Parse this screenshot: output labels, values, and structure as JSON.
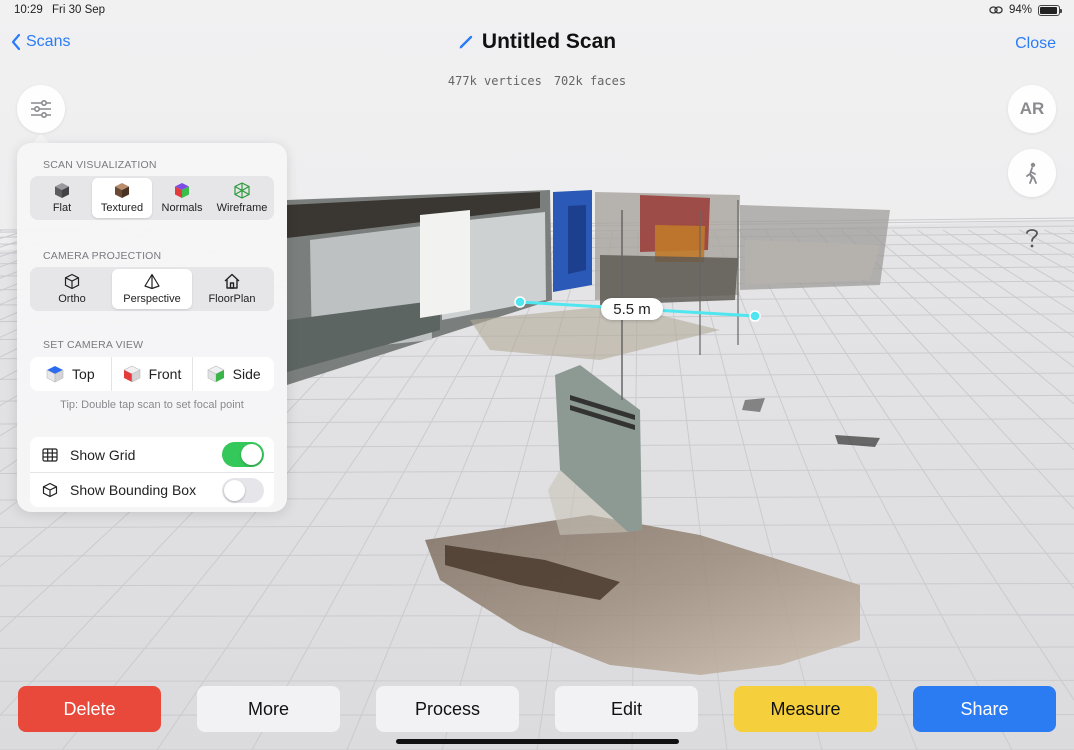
{
  "status_bar": {
    "time": "10:29",
    "date": "Fri 30 Sep",
    "battery": "94%",
    "battery_level": 0.94
  },
  "nav": {
    "back_label": "Scans",
    "title": "Untitled Scan",
    "close_label": "Close"
  },
  "stats": {
    "vertices": "477k vertices",
    "faces": "702k faces"
  },
  "buttons": {
    "ar_label": "AR"
  },
  "panel": {
    "visualization": {
      "title": "SCAN VISUALIZATION",
      "items": [
        {
          "label": "Flat",
          "icon": "cube-flat-icon"
        },
        {
          "label": "Textured",
          "icon": "cube-textured-icon",
          "selected": true
        },
        {
          "label": "Normals",
          "icon": "cube-normals-icon"
        },
        {
          "label": "Wireframe",
          "icon": "cube-wireframe-icon"
        }
      ]
    },
    "projection": {
      "title": "CAMERA PROJECTION",
      "items": [
        {
          "label": "Ortho",
          "icon": "cube-outline-icon"
        },
        {
          "label": "Perspective",
          "icon": "pyramid-icon",
          "selected": true
        },
        {
          "label": "FloorPlan",
          "icon": "house-icon"
        }
      ]
    },
    "camera_view": {
      "title": "SET CAMERA VIEW",
      "items": [
        {
          "label": "Top",
          "icon": "cube-top-icon"
        },
        {
          "label": "Front",
          "icon": "cube-front-icon"
        },
        {
          "label": "Side",
          "icon": "cube-side-icon"
        }
      ],
      "tip": "Tip: Double tap scan to set focal point"
    },
    "toggles": {
      "show_grid": {
        "label": "Show Grid",
        "on": true
      },
      "show_bounding_box": {
        "label": "Show Bounding Box",
        "on": false
      }
    }
  },
  "measurement": {
    "label": "5.5 m"
  },
  "toolbar": {
    "delete": "Delete",
    "more": "More",
    "process": "Process",
    "edit": "Edit",
    "measure": "Measure",
    "share": "Share"
  },
  "colors": {
    "accent": "#2a7cf6",
    "delete": "#e9493b",
    "measure": "#f5cf3c",
    "share": "#2b7bf3",
    "toggle_on": "#34c759",
    "measure_line": "#4fe6ef"
  }
}
